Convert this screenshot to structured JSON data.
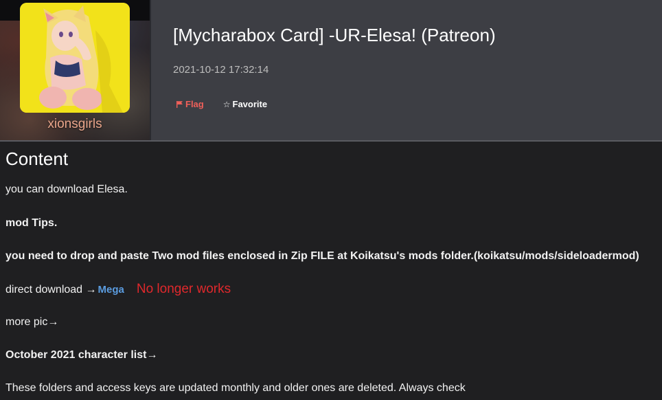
{
  "header": {
    "username": "xionsgirls",
    "title": "[Mycharabox Card] -UR-Elesa! (Patreon)",
    "date": "2021-10-12 17:32:14",
    "actions": {
      "flag_label": "Flag",
      "favorite_label": "Favorite",
      "flag_icon": "flag-icon",
      "favorite_icon": "star-icon"
    }
  },
  "content": {
    "heading": "Content",
    "lines": {
      "download": "you can download  Elesa.",
      "mod_tips": "mod Tips.",
      "instructions": "you need to drop and paste Two mod files enclosed in Zip FILE at Koikatsu's mods folder.(koikatsu/mods/sideloadermod)",
      "direct_download_prefix": "direct download →",
      "mega_link": "Mega",
      "no_longer_works": "No longer works",
      "more_pic": "more pic→",
      "character_list": "October 2021 character list→",
      "folders_note": "These folders and access keys are updated monthly and older ones are deleted. Always check"
    }
  },
  "colors": {
    "header_bg": "#3d3e44",
    "page_bg": "#1f1f21",
    "username": "#e9a58a",
    "flag": "#f0605a",
    "link": "#5b9ce0",
    "warning": "#e0282c",
    "avatar_bg": "#f2e21a"
  }
}
